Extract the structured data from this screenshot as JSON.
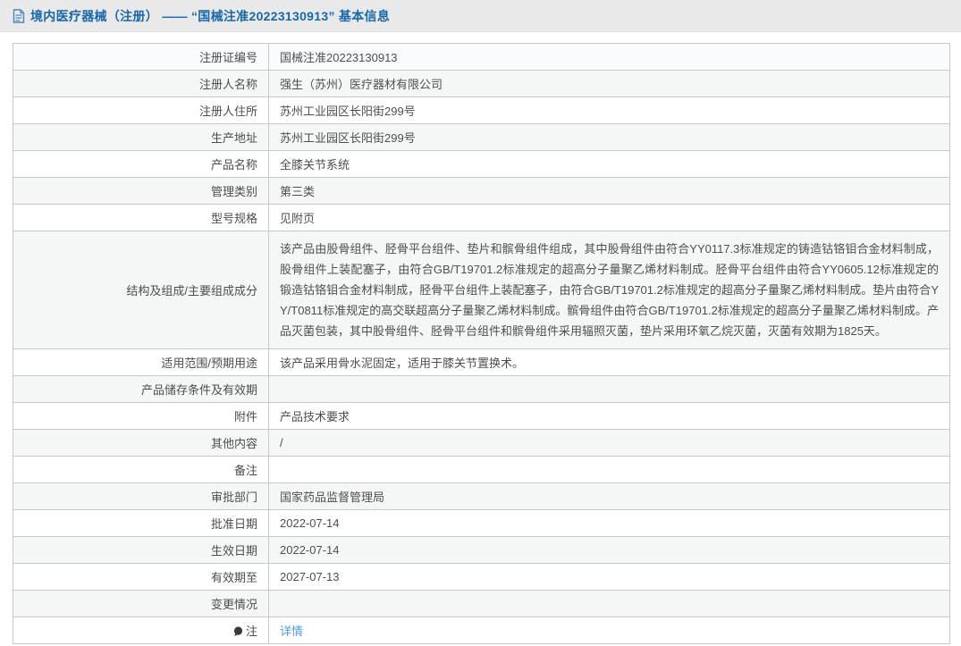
{
  "header": {
    "title": "境内医疗器械（注册） —— “国械注准20223130913” 基本信息",
    "icon": "document-icon"
  },
  "colors": {
    "title_blue": "#1767a9",
    "link_blue": "#5599dd",
    "header_strip_gray": "#e9e9e9",
    "row_stripe_gray": "#f5f6f6",
    "border_gray": "#c9c9c9",
    "text_gray": "#4f4f4f"
  },
  "table": {
    "rows": [
      {
        "label": "注册证编号",
        "value": "国械注准20223130913"
      },
      {
        "label": "注册人名称",
        "value": "强生（苏州）医疗器材有限公司"
      },
      {
        "label": "注册人住所",
        "value": "苏州工业园区长阳街299号"
      },
      {
        "label": "生产地址",
        "value": "苏州工业园区长阳街299号"
      },
      {
        "label": "产品名称",
        "value": "全膝关节系统"
      },
      {
        "label": "管理类别",
        "value": "第三类"
      },
      {
        "label": "型号规格",
        "value": "见附页"
      },
      {
        "label": "结构及组成/主要组成成分",
        "value": "该产品由股骨组件、胫骨平台组件、垫片和髌骨组件组成，其中股骨组件由符合YY0117.3标准规定的铸造钴铬钼合金材料制成，股骨组件上装配塞子，由符合GB/T19701.2标准规定的超高分子量聚乙烯材料制成。胫骨平台组件由符合YY0605.12标准规定的锻造钴铬钼合金材料制成，胫骨平台组件上装配塞子，由符合GB/T19701.2标准规定的超高分子量聚乙烯材料制成。垫片由符合YY/T0811标准规定的高交联超高分子量聚乙烯材料制成。髌骨组件由符合GB/T19701.2标准规定的超高分子量聚乙烯材料制成。产品灭菌包装，其中股骨组件、胫骨平台组件和髌骨组件采用辐照灭菌，垫片采用环氧乙烷灭菌，灭菌有效期为1825天。"
      },
      {
        "label": "适用范围/预期用途",
        "value": "该产品采用骨水泥固定，适用于膝关节置换术。"
      },
      {
        "label": "产品储存条件及有效期",
        "value": ""
      },
      {
        "label": "附件",
        "value": "产品技术要求"
      },
      {
        "label": "其他内容",
        "value": "/"
      },
      {
        "label": "备注",
        "value": ""
      },
      {
        "label": "审批部门",
        "value": "国家药品监督管理局"
      },
      {
        "label": "批准日期",
        "value": "2022-07-14"
      },
      {
        "label": "生效日期",
        "value": "2022-07-14"
      },
      {
        "label": "有效期至",
        "value": "2027-07-13"
      },
      {
        "label": "变更情况",
        "value": ""
      },
      {
        "label": "注",
        "value": "详情",
        "note_icon": "speech-bubble-icon"
      }
    ]
  }
}
